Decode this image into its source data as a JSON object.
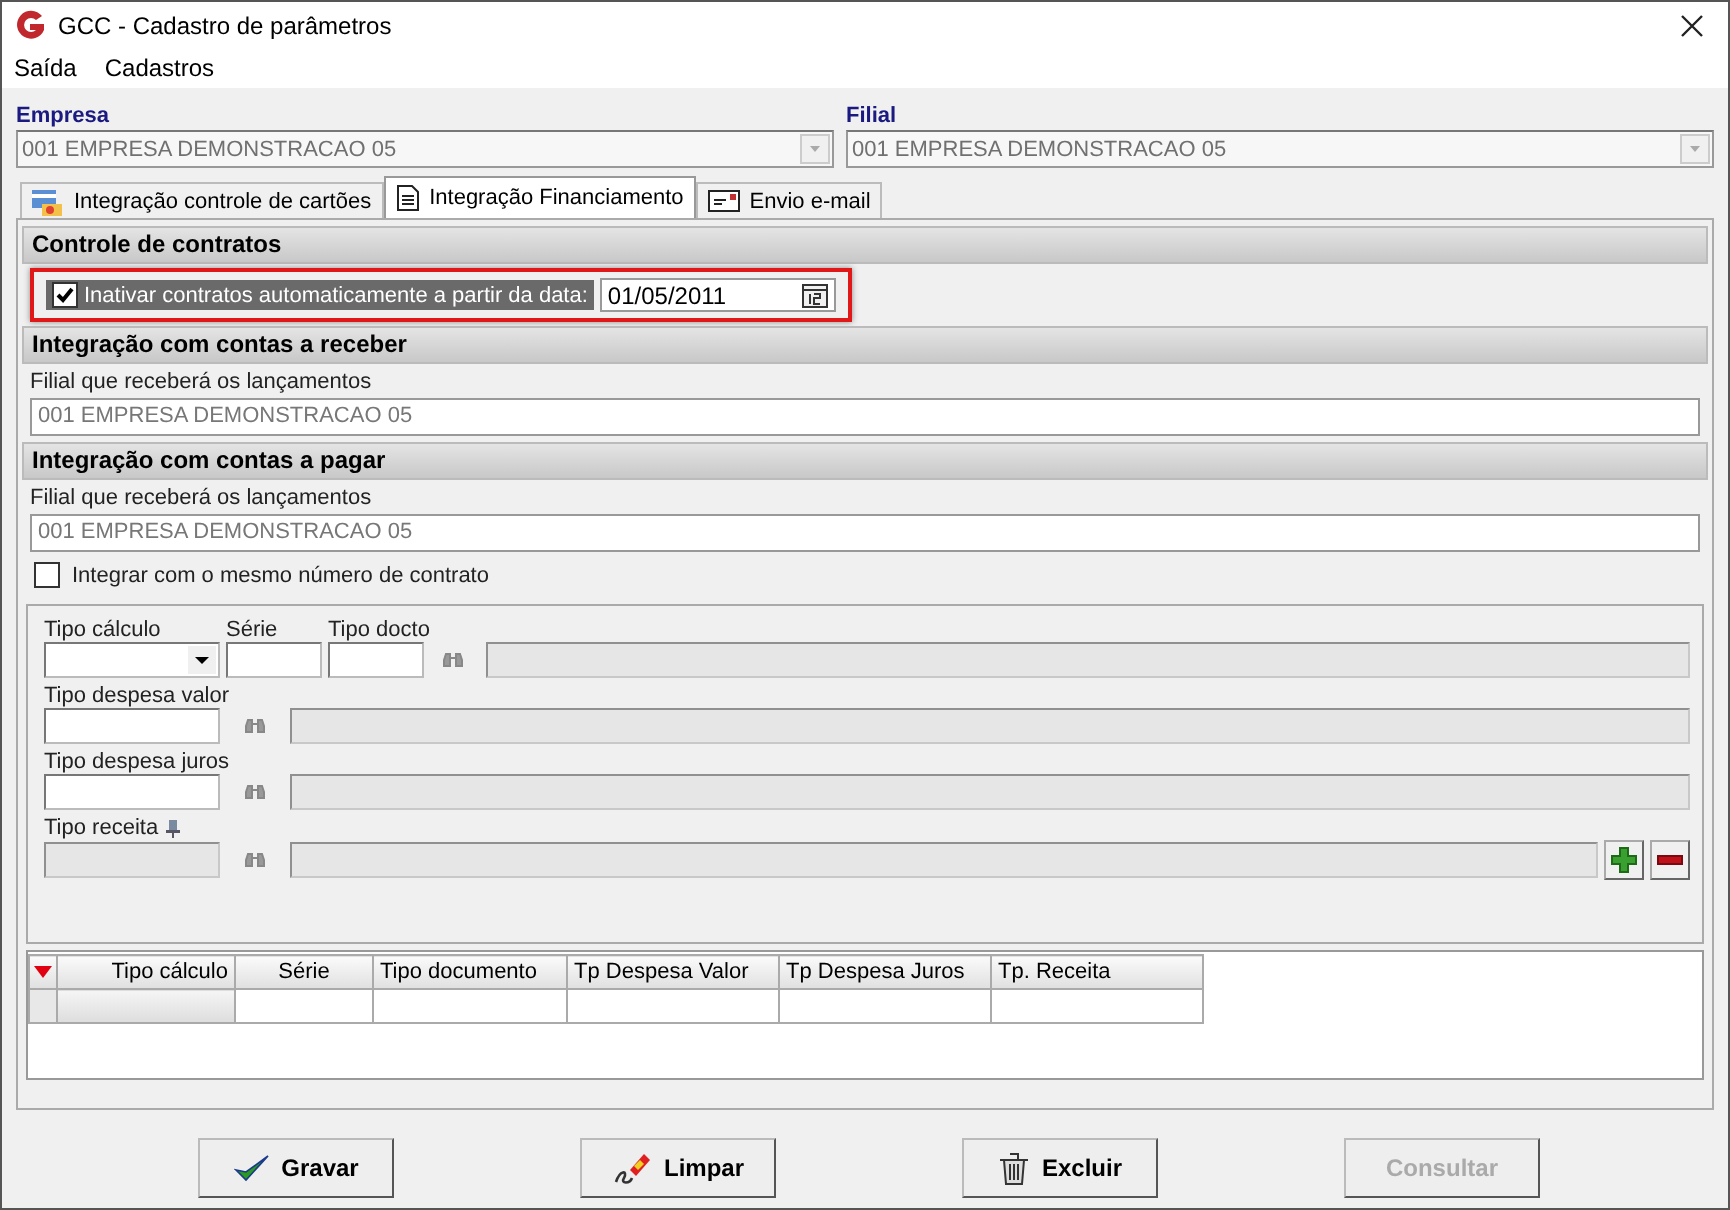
{
  "window": {
    "title": "GCC - Cadastro de parâmetros"
  },
  "menu": [
    {
      "label": "Saída"
    },
    {
      "label": "Cadastros"
    }
  ],
  "empresa": {
    "label": "Empresa",
    "value": "001 EMPRESA DEMONSTRACAO 05"
  },
  "filial": {
    "label": "Filial",
    "value": "001 EMPRESA DEMONSTRACAO 05"
  },
  "tabs": [
    {
      "label": "Integração controle de cartões",
      "selected": false,
      "kind": "cards"
    },
    {
      "label": "Integração Financiamento",
      "selected": true,
      "kind": "document"
    },
    {
      "label": "Envio e-mail",
      "selected": false,
      "kind": "mail"
    }
  ],
  "controle": {
    "title": "Controle de contratos",
    "checkbox": {
      "label": "Inativar contratos automaticamente a partir da data:",
      "checked": true
    },
    "date": "01/05/2011"
  },
  "receber": {
    "title": "Integração com contas a receber",
    "field_label": "Filial que receberá os lançamentos",
    "value": "001 EMPRESA DEMONSTRACAO 05"
  },
  "pagar": {
    "title": "Integração com contas a pagar",
    "field_label": "Filial que receberá os lançamentos",
    "value": "001 EMPRESA DEMONSTRACAO 05",
    "checkbox": {
      "label": "Integrar com o mesmo número de contrato",
      "checked": false
    }
  },
  "row1": [
    {
      "label": "Tipo cálculo",
      "kind": "combo"
    },
    {
      "label": "Série",
      "kind": "text"
    },
    {
      "label": "Tipo docto",
      "kind": "lookup"
    }
  ],
  "lookups": [
    {
      "label": "Tipo despesa valor",
      "disabled": false,
      "pin": false
    },
    {
      "label": "Tipo despesa juros",
      "disabled": false,
      "pin": false
    },
    {
      "label": "Tipo receita",
      "disabled": true,
      "pin": true
    }
  ],
  "grid": {
    "columns": [
      "Tipo cálculo",
      "Série",
      "Tipo documento",
      "Tp Despesa Valor",
      "Tp Despesa Juros",
      "Tp. Receita"
    ]
  },
  "buttons": [
    {
      "label": "Gravar",
      "kind": "check",
      "disabled": false
    },
    {
      "label": "Limpar",
      "kind": "eraser",
      "disabled": false
    },
    {
      "label": "Excluir",
      "kind": "trash",
      "disabled": false
    },
    {
      "label": "Consultar",
      "kind": "none",
      "disabled": true
    }
  ]
}
